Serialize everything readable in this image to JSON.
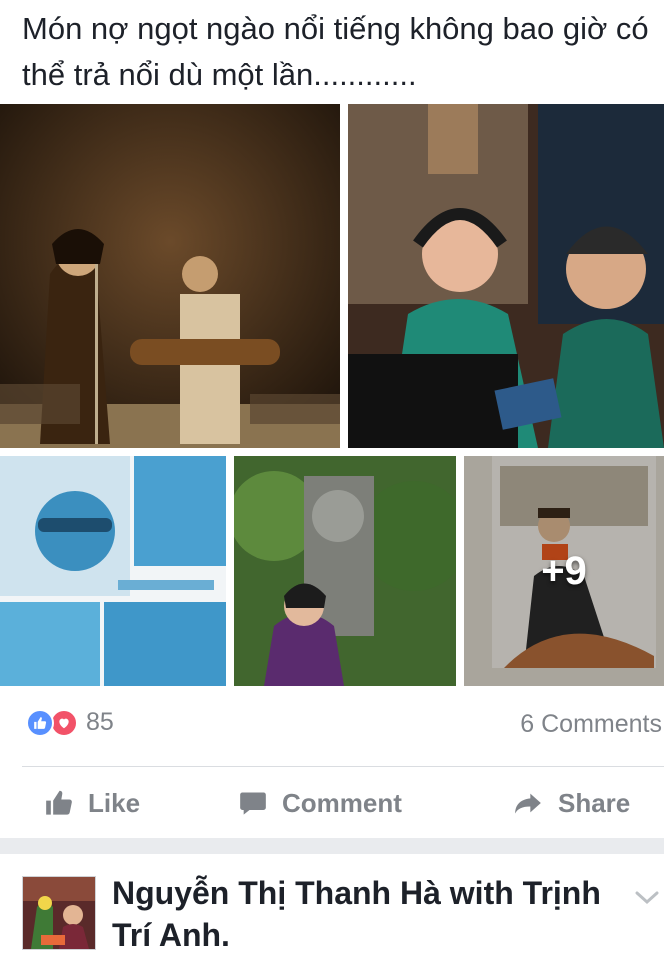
{
  "post": {
    "caption": "Món nợ ngọt ngào nổi tiếng không bao giờ có thể trả nổi dù một lần............",
    "more_photos": "+9"
  },
  "reactions": {
    "count": "85",
    "icons": [
      "like-icon",
      "love-icon"
    ],
    "like_color": "#5890ff",
    "love_color": "#f25268"
  },
  "comments": {
    "count_label": "6 Comments"
  },
  "actions": {
    "like_label": "Like",
    "comment_label": "Comment",
    "share_label": "Share"
  },
  "next_post": {
    "author": "Nguyễn Thị Thanh Hà",
    "with_word": "with",
    "tagged": "Trịnh Trí Anh."
  },
  "colors": {
    "text_primary": "#1d2129",
    "text_secondary": "#7f8389",
    "separator_band": "#e9ebee"
  }
}
